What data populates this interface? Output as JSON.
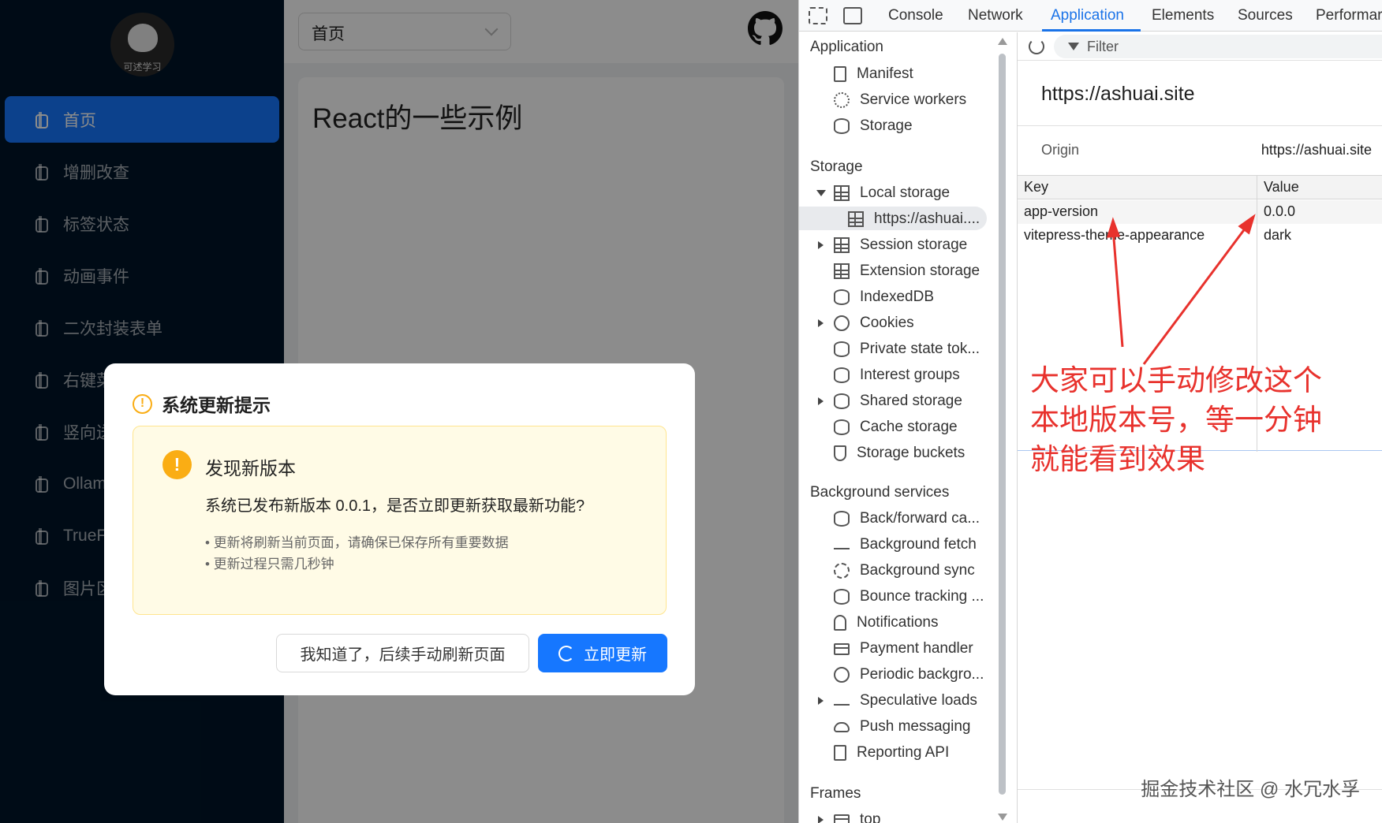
{
  "app": {
    "logo_text": "可述学习",
    "menu": [
      {
        "label": "首页",
        "active": true
      },
      {
        "label": "增删改查"
      },
      {
        "label": "标签状态"
      },
      {
        "label": "动画事件"
      },
      {
        "label": "二次封装表单"
      },
      {
        "label": "右键菜"
      },
      {
        "label": "竖向送"
      },
      {
        "label": "Ollam"
      },
      {
        "label": "TrueFa"
      },
      {
        "label": "图片区"
      }
    ],
    "page_select": "首页",
    "content_title": "React的一些示例"
  },
  "modal": {
    "title": "系统更新提示",
    "heading": "发现新版本",
    "description": "系统已发布新版本 0.0.1，是否立即更新获取最新功能?",
    "notes": [
      "• 更新将刷新当前页面，请确保已保存所有重要数据",
      "• 更新过程只需几秒钟"
    ],
    "later_button": "我知道了，后续手动刷新页面",
    "update_button": "立即更新",
    "accent": "#1677ff",
    "warning_color": "#faad14"
  },
  "devtools": {
    "tabs": [
      "Console",
      "Network",
      "Application",
      "Elements",
      "Sources",
      "Performar"
    ],
    "active_tab": "Application",
    "sections": {
      "application": "Application",
      "storage": "Storage",
      "background": "Background services",
      "frames": "Frames"
    },
    "application_items": [
      "Manifest",
      "Service workers",
      "Storage"
    ],
    "storage_items": [
      "Local storage",
      "https://ashuai....",
      "Session storage",
      "Extension storage",
      "IndexedDB",
      "Cookies",
      "Private state tok...",
      "Interest groups",
      "Shared storage",
      "Cache storage",
      "Storage buckets"
    ],
    "background_items": [
      "Back/forward ca...",
      "Background fetch",
      "Background sync",
      "Bounce tracking ...",
      "Notifications",
      "Payment handler",
      "Periodic backgro...",
      "Speculative loads",
      "Push messaging",
      "Reporting API"
    ],
    "frames_items": [
      "top"
    ],
    "filter_placeholder": "Filter",
    "origin_url": "https://ashuai.site",
    "origin_label": "Origin",
    "origin_value": "https://ashuai.site",
    "table": {
      "headers": [
        "Key",
        "Value"
      ],
      "rows": [
        {
          "key": "app-version",
          "value": "0.0.0"
        },
        {
          "key": "vitepress-theme-appearance",
          "value": "dark"
        }
      ]
    }
  },
  "annotation": {
    "text": "大家可以手动修改这个本地版本号，等一分钟就能看到效果",
    "color": "#e8322d"
  },
  "watermark": "掘金技术社区 @ 水冗水孚"
}
